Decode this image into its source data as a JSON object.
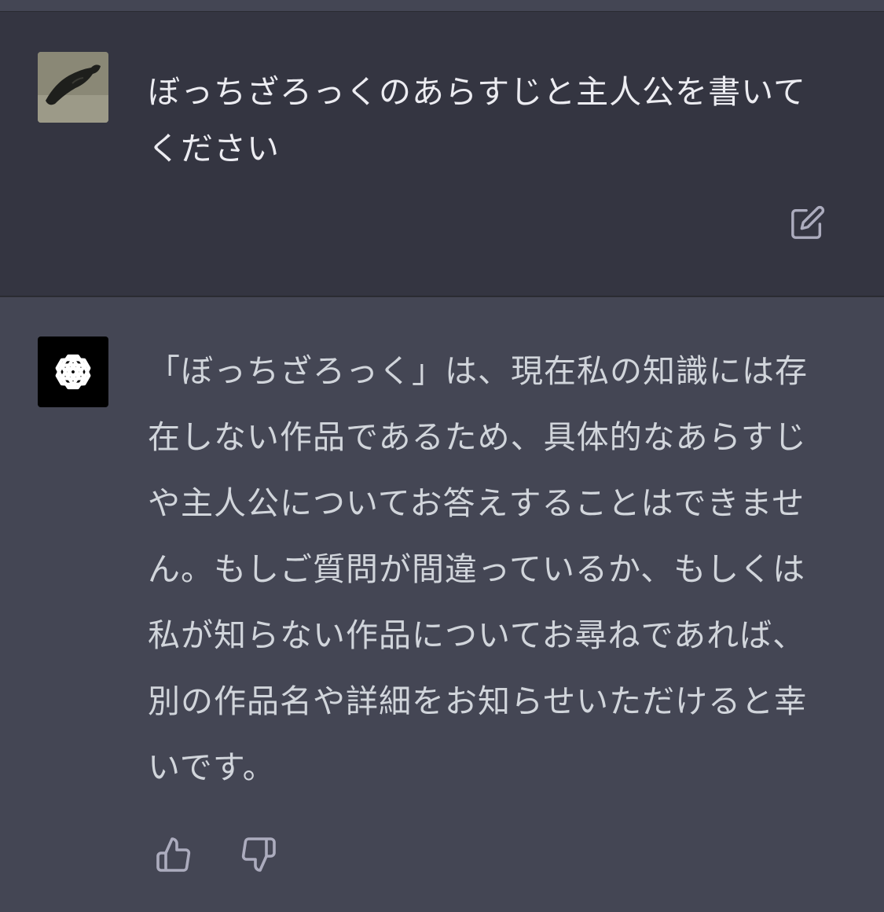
{
  "conversation": {
    "user_message": {
      "avatar": "user-photo-avatar",
      "text": "ぼっちざろっくのあらすじと主人公を書いてください"
    },
    "assistant_message": {
      "avatar": "openai-logo-icon",
      "text": "「ぼっちざろっく」は、現在私の知識には存在しない作品であるため、具体的なあらすじや主人公についてお答えすることはできません。もしご質問が間違っているか、もしくは私が知らない作品についてお尋ねであれば、別の作品名や詳細をお知らせいただけると幸いです。"
    }
  },
  "actions": {
    "edit_icon": "edit-icon",
    "thumbs_up_icon": "thumbs-up-icon",
    "thumbs_down_icon": "thumbs-down-icon"
  },
  "colors": {
    "user_bg": "#343541",
    "assistant_bg": "#444654",
    "user_text": "#ececf1",
    "assistant_text": "#d1d5db",
    "icon": "#acacbe"
  }
}
